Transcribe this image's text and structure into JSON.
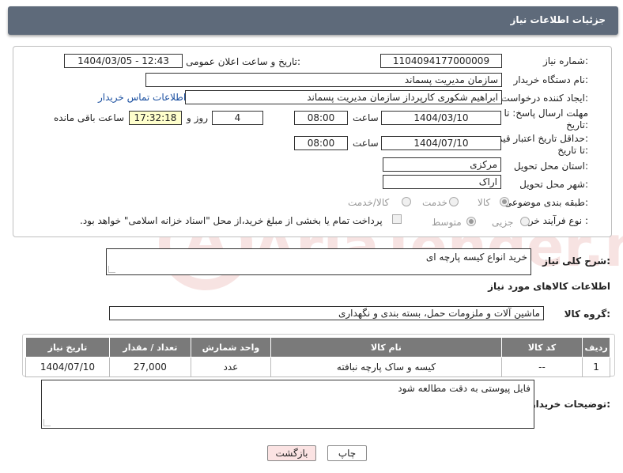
{
  "header": {
    "title": "جزئیات اطلاعات نیاز"
  },
  "need_number": {
    "label": "شماره نیاز:",
    "value": "1104094177000009"
  },
  "announce_datetime": {
    "label": "تاریخ و ساعت اعلان عمومی:",
    "value": "1404/03/05 - 12:43"
  },
  "buyer_org": {
    "label": "نام دستگاه خریدار:",
    "value": "سازمان مدیریت پسماند"
  },
  "requester": {
    "label": "ایجاد کننده درخواست:",
    "value": "ابراهیم شکوری کارپرداز سازمان مدیریت پسماند",
    "contact_link": "اطلاعات تماس خریدار"
  },
  "reply_deadline": {
    "label_line1": "مهلت ارسال پاسخ: تا",
    "label_line2": "تاریخ:",
    "date": "1404/03/10",
    "time_label": "ساعت",
    "time": "08:00",
    "days": "4",
    "days_label": "روز و",
    "remaining": "17:32:18",
    "remaining_label": "ساعت باقی مانده"
  },
  "price_validity": {
    "label_line1": "حداقل تاریخ اعتبار قیمت:",
    "label_line2": "تا تاریخ:",
    "date": "1404/07/10",
    "time_label": "ساعت",
    "time": "08:00"
  },
  "delivery_province": {
    "label": "استان محل تحویل:",
    "value": "مرکزی"
  },
  "delivery_city": {
    "label": "شهر محل تحویل:",
    "value": "اراک"
  },
  "category": {
    "label": "طبقه بندی موضوعی:",
    "options": [
      "کالا",
      "خدمت",
      "کالا/خدمت"
    ],
    "selected": "کالا"
  },
  "purchase_type": {
    "label": "نوع فرآیند خرید :",
    "options": [
      "جزیی",
      "متوسط"
    ],
    "selected": "متوسط",
    "note": "پرداخت تمام یا بخشی از مبلغ خرید،از محل \"اسناد خزانه اسلامی\" خواهد بود."
  },
  "general_desc": {
    "label": "شرح کلی نیاز:",
    "value": "خرید انواع کیسه پارچه ای"
  },
  "goods_info_title": "اطلاعات کالاهای مورد نیاز",
  "goods_group": {
    "label": "گروه کالا:",
    "value": "ماشین آلات و ملزومات حمل، بسته بندی و نگهداری"
  },
  "goods_table": {
    "headers": [
      "ردیف",
      "کد کالا",
      "نام کالا",
      "واحد شمارش",
      "تعداد / مقدار",
      "تاریخ نیاز"
    ],
    "rows": [
      [
        "1",
        "--",
        "کیسه و ساک پارچه نبافته",
        "عدد",
        "27,000",
        "1404/07/10"
      ]
    ]
  },
  "buyer_notes": {
    "label": "توضیحات خریدار:",
    "value": "فایل پیوستی به دقت مطالعه شود"
  },
  "buttons": {
    "print": "چاپ",
    "back": "بازگشت"
  },
  "watermark": {
    "text": "AriaTender.net",
    "color": "#c9302c"
  }
}
